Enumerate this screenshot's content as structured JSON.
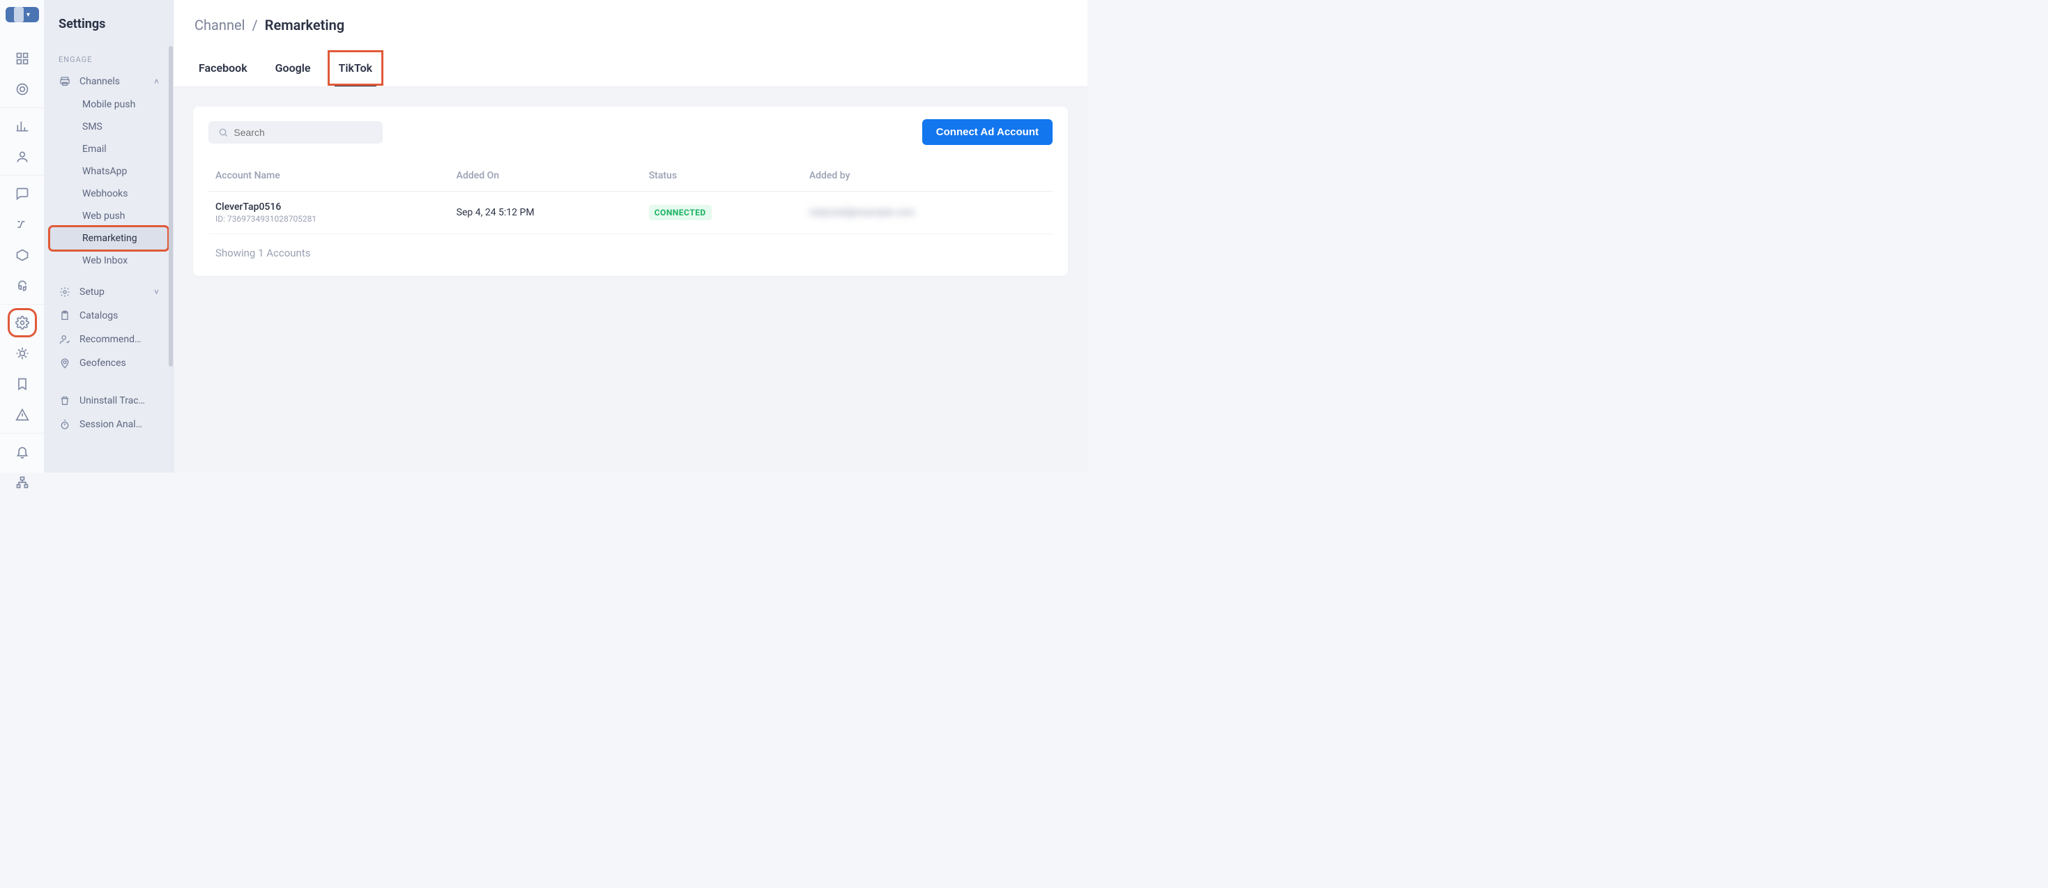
{
  "rail": {
    "switcher_tooltip": "project-switcher"
  },
  "sidebar": {
    "title": "Settings",
    "section_label": "ENGAGE",
    "channels": {
      "label": "Channels",
      "items": [
        "Mobile push",
        "SMS",
        "Email",
        "WhatsApp",
        "Webhooks",
        "Web push",
        "Remarketing",
        "Web Inbox"
      ],
      "active_index": 6
    },
    "other": [
      {
        "label": "Setup",
        "expandable": true
      },
      {
        "label": "Catalogs"
      },
      {
        "label": "Recommend…"
      },
      {
        "label": "Geofences"
      },
      {
        "label": "Uninstall Trac…"
      },
      {
        "label": "Session Anal…"
      }
    ]
  },
  "breadcrumb": {
    "parent": "Channel",
    "current": "Remarketing"
  },
  "tabs": {
    "items": [
      "Facebook",
      "Google",
      "TikTok"
    ],
    "active_index": 2
  },
  "search": {
    "placeholder": "Search"
  },
  "primary_button": "Connect Ad Account",
  "table": {
    "columns": [
      "Account Name",
      "Added On",
      "Status",
      "Added by"
    ],
    "rows": [
      {
        "name": "CleverTap0516",
        "id_label": "ID: 7369734931028705281",
        "added_on": "Sep 4, 24 5:12 PM",
        "status": "CONNECTED",
        "added_by": "redacted@example.com"
      }
    ],
    "footer": "Showing 1 Accounts"
  }
}
